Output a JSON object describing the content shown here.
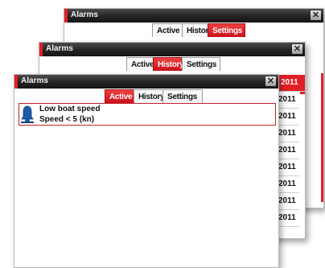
{
  "windows": {
    "back": {
      "title": "Alarms",
      "tabs": [
        "Active",
        "History",
        "Settings"
      ],
      "active_tab": "Settings"
    },
    "middle": {
      "title": "Alarms",
      "tabs": [
        "Active",
        "History",
        "Settings"
      ],
      "active_tab": "History",
      "history_dates": [
        "2011",
        "2011",
        "2011",
        "2011",
        "2011",
        "2011",
        "2011",
        "2011",
        "2011"
      ]
    },
    "front": {
      "title": "Alarms",
      "tabs": [
        "Active",
        "History",
        "Settings"
      ],
      "active_tab": "Active",
      "alarms": [
        {
          "name": "Low boat speed",
          "condition": "Speed < 5 (kn)",
          "icon": "bell-icon"
        }
      ]
    }
  },
  "colors": {
    "accent": "#e21e26",
    "titlebar": "#1c1c1c",
    "alarm_icon": "#1e5aa8"
  },
  "icons": {
    "close": "close-icon",
    "alarm": "bell-icon"
  }
}
